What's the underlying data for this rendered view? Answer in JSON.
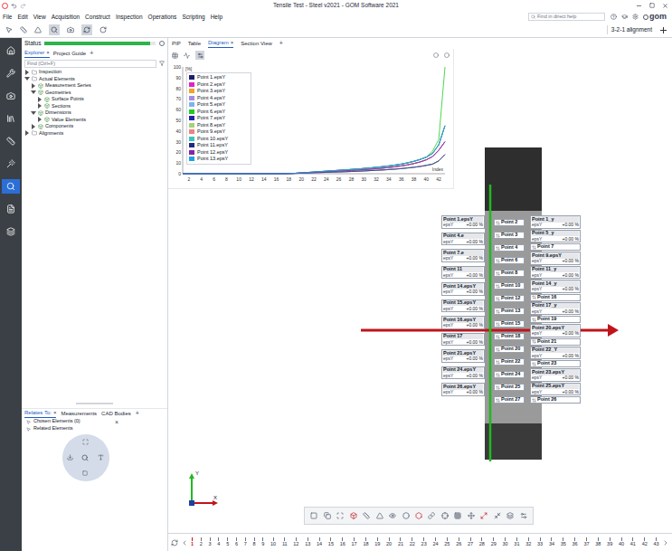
{
  "window": {
    "title": "Tensile Test - Steel v2021 - GOM Software 2021"
  },
  "menu": [
    "File",
    "Edit",
    "View",
    "Acquisition",
    "Construct",
    "Inspection",
    "Operations",
    "Scripting",
    "Help"
  ],
  "help_search": {
    "placeholder": "Find in direct help"
  },
  "logo": "gom",
  "toolbar": {
    "alignment": "3-2-1 alignment"
  },
  "sidebar": {
    "items": [
      {
        "selected": false
      },
      {
        "selected": false
      },
      {
        "selected": false
      },
      {
        "selected": false
      },
      {
        "selected": false
      },
      {
        "selected": false
      },
      {
        "selected": true
      },
      {
        "selected": false
      },
      {
        "selected": false
      }
    ]
  },
  "status": {
    "label": "Status",
    "level": 0.95
  },
  "explorer": {
    "tabs": [
      {
        "label": "Explorer",
        "selected": true,
        "close": "×"
      },
      {
        "label": "Project Guide",
        "selected": false,
        "close": ""
      }
    ],
    "add": "+",
    "filter": {
      "placeholder": "Find (Ctrl+F)"
    },
    "tree": [
      {
        "label": "Inspection",
        "level": 0,
        "expanded": false
      },
      {
        "label": "Actual Elements",
        "level": 0,
        "expanded": true
      },
      {
        "label": "Measurement Series",
        "level": 1,
        "expanded": false
      },
      {
        "label": "Geometries",
        "level": 1,
        "expanded": true
      },
      {
        "label": "Surface Points",
        "level": 2,
        "expanded": false
      },
      {
        "label": "Sections",
        "level": 2,
        "expanded": false
      },
      {
        "label": "Dimensions",
        "level": 1,
        "expanded": true
      },
      {
        "label": "Value Elements",
        "level": 2,
        "expanded": false
      },
      {
        "label": "Components",
        "level": 1,
        "expanded": false
      },
      {
        "label": "Alignments",
        "level": 0,
        "expanded": false
      }
    ]
  },
  "relates": {
    "tabs": [
      {
        "label": "Relates To:",
        "selected": true,
        "close": "×"
      },
      {
        "label": "Measurements",
        "selected": false,
        "close": ""
      },
      {
        "label": "CAD Bodies",
        "selected": false,
        "close": ""
      }
    ],
    "add": "+",
    "rows": [
      {
        "label": "Chosen Elements (0)",
        "close": "×"
      },
      {
        "label": "Related Elements",
        "close": ""
      }
    ]
  },
  "main_tabs": {
    "tabs": [
      {
        "label": "PIP",
        "selected": false,
        "close": ""
      },
      {
        "label": "Table",
        "selected": false,
        "close": ""
      },
      {
        "label": "Diagram",
        "selected": true,
        "close": "×"
      },
      {
        "label": "Section View",
        "selected": false,
        "close": ""
      }
    ],
    "add": "+"
  },
  "chart": {
    "unit": "[%]",
    "y_max": 100,
    "x_label": "Index",
    "y_ticks": [
      "0",
      "10",
      "20",
      "30",
      "40",
      "50",
      "60",
      "70",
      "80",
      "90",
      "100"
    ],
    "x_ticks": [
      "2",
      "4",
      "6",
      "8",
      "10",
      "12",
      "14",
      "16",
      "18",
      "20",
      "22",
      "24",
      "26",
      "28",
      "30",
      "32",
      "34",
      "36",
      "38",
      "40",
      "42"
    ],
    "series": [
      {
        "name": "Point 1.epsY",
        "color": "#1b1f6e",
        "values": [
          0,
          0,
          0,
          0,
          0,
          0,
          0,
          0,
          0,
          0,
          0,
          0,
          0,
          0,
          0,
          0,
          0,
          0.2,
          0.4,
          0.7,
          1.0,
          1.3,
          1.6,
          1.9,
          2.2,
          2.5,
          2.8,
          3.1,
          3.4,
          3.8,
          4.2,
          4.7,
          5.2,
          5.8,
          6.5,
          7.3,
          8.3,
          9.5,
          11,
          13,
          16,
          22,
          30
        ]
      },
      {
        "name": "Point 2.epsY",
        "color": "#e021c4",
        "values": [
          0,
          0,
          0,
          0,
          0,
          0,
          0,
          0,
          0,
          0,
          0,
          0,
          0,
          0,
          0,
          0,
          0,
          0.2,
          0.3,
          0.5,
          0.7,
          0.9,
          1.1,
          1.3,
          1.5,
          1.7,
          1.9,
          2.1,
          2.3,
          2.6,
          2.9,
          3.2,
          3.5,
          3.9,
          4.3,
          4.8,
          5.4,
          6.0,
          6.8,
          7.8,
          9.0,
          12,
          18
        ]
      },
      {
        "name": "Point 3.epsY",
        "color": "#f2a12a",
        "values": [
          0,
          0,
          0,
          0,
          0,
          0,
          0,
          0,
          0,
          0,
          0,
          0,
          0,
          0,
          0,
          0,
          0,
          0.2,
          0.4,
          0.8,
          1.2,
          1.6,
          2.0,
          2.4,
          2.8,
          3.2,
          3.6,
          4.0,
          4.4,
          4.9,
          5.4,
          6.0,
          6.6,
          7.3,
          8.1,
          9.0,
          10.2,
          11.6,
          13.3,
          15.5,
          19,
          27,
          45
        ]
      },
      {
        "name": "Point 4.epsY",
        "color": "#a08de0",
        "values": [
          0,
          0,
          0,
          0,
          0,
          0,
          0,
          0,
          0,
          0,
          0,
          0,
          0,
          0,
          0,
          0,
          0,
          0.2,
          0.4,
          0.7,
          1.0,
          1.3,
          1.6,
          1.9,
          2.2,
          2.5,
          2.8,
          3.1,
          3.4,
          3.8,
          4.2,
          4.7,
          5.2,
          5.8,
          6.5,
          7.3,
          8.3,
          9.5,
          11,
          13,
          16,
          22,
          30
        ]
      },
      {
        "name": "Point 5.epsY",
        "color": "#7fb2f0",
        "values": [
          0,
          0,
          0,
          0,
          0,
          0,
          0,
          0,
          0,
          0,
          0,
          0,
          0,
          0,
          0,
          0,
          0,
          0.2,
          0.3,
          0.5,
          0.7,
          0.9,
          1.1,
          1.3,
          1.5,
          1.7,
          1.9,
          2.1,
          2.3,
          2.6,
          2.9,
          3.2,
          3.5,
          3.9,
          4.3,
          4.8,
          5.4,
          6.0,
          6.8,
          7.8,
          9.0,
          12,
          18
        ]
      },
      {
        "name": "Point 6.epsY",
        "color": "#22cc22",
        "values": [
          0,
          0,
          0,
          0,
          0,
          0,
          0,
          0,
          0,
          0,
          0,
          0,
          0,
          0,
          0,
          0,
          0,
          0.2,
          0.4,
          0.8,
          1.2,
          1.6,
          2.0,
          2.4,
          2.8,
          3.2,
          3.6,
          4.0,
          4.4,
          4.9,
          5.4,
          6.0,
          6.6,
          7.3,
          8.1,
          9.0,
          10.2,
          11.6,
          13.3,
          15.5,
          21,
          32,
          100
        ]
      },
      {
        "name": "Point 7.epsY",
        "color": "#2424a8",
        "values": [
          0,
          0,
          0,
          0,
          0,
          0,
          0,
          0,
          0,
          0,
          0,
          0,
          0,
          0,
          0,
          0,
          0,
          0.2,
          0.4,
          0.8,
          1.2,
          1.6,
          2.0,
          2.4,
          2.8,
          3.2,
          3.6,
          4.0,
          4.4,
          4.9,
          5.4,
          6.0,
          6.6,
          7.3,
          8.1,
          9.0,
          10.2,
          11.6,
          13.3,
          15.5,
          19,
          27,
          45
        ]
      },
      {
        "name": "Point 8.epsY",
        "color": "#a2d37e",
        "values": [
          0,
          0,
          0,
          0,
          0,
          0,
          0,
          0,
          0,
          0,
          0,
          0,
          0,
          0,
          0,
          0,
          0,
          0.2,
          0.3,
          0.5,
          0.7,
          0.9,
          1.1,
          1.3,
          1.5,
          1.7,
          1.9,
          2.1,
          2.3,
          2.6,
          2.9,
          3.2,
          3.5,
          3.9,
          4.3,
          4.8,
          5.4,
          6.0,
          6.8,
          7.8,
          9.0,
          12,
          18
        ]
      },
      {
        "name": "Point 9.epsY",
        "color": "#f08282",
        "values": [
          0,
          0,
          0,
          0,
          0,
          0,
          0,
          0,
          0,
          0,
          0,
          0,
          0,
          0,
          0,
          0,
          0,
          0.2,
          0.4,
          0.7,
          1.0,
          1.3,
          1.6,
          1.9,
          2.2,
          2.5,
          2.8,
          3.1,
          3.4,
          3.8,
          4.2,
          4.7,
          5.2,
          5.8,
          6.5,
          7.3,
          8.3,
          9.5,
          11,
          13,
          16,
          22,
          30
        ]
      },
      {
        "name": "Point 10.epsY",
        "color": "#3fc2c2",
        "values": [
          0,
          0,
          0,
          0,
          0,
          0,
          0,
          0,
          0,
          0,
          0,
          0,
          0,
          0,
          0,
          0,
          0,
          0.2,
          0.4,
          0.8,
          1.2,
          1.6,
          2.0,
          2.4,
          2.8,
          3.2,
          3.6,
          4.0,
          4.4,
          4.9,
          5.4,
          6.0,
          6.6,
          7.3,
          8.1,
          9.0,
          10.2,
          11.6,
          13.3,
          15.5,
          19,
          27,
          45
        ]
      },
      {
        "name": "Point 11.epsY",
        "color": "#1f2a80",
        "values": [
          0,
          0,
          0,
          0,
          0,
          0,
          0,
          0,
          0,
          0,
          0,
          0,
          0,
          0,
          0,
          0,
          0,
          0.2,
          0.3,
          0.5,
          0.7,
          0.9,
          1.1,
          1.3,
          1.5,
          1.7,
          1.9,
          2.1,
          2.3,
          2.6,
          2.9,
          3.2,
          3.5,
          3.9,
          4.3,
          4.8,
          5.4,
          6.0,
          6.8,
          7.8,
          9.0,
          12,
          18
        ]
      },
      {
        "name": "Point 12.epsY",
        "color": "#8624a4",
        "values": [
          0,
          0,
          0,
          0,
          0,
          0,
          0,
          0,
          0,
          0,
          0,
          0,
          0,
          0,
          0,
          0,
          0,
          0.2,
          0.4,
          0.7,
          1.0,
          1.3,
          1.6,
          1.9,
          2.2,
          2.5,
          2.8,
          3.1,
          3.4,
          3.8,
          4.2,
          4.7,
          5.2,
          5.8,
          6.5,
          7.3,
          8.3,
          9.5,
          11,
          13,
          16,
          22,
          30
        ]
      },
      {
        "name": "Point 13.epsY",
        "color": "#20a2e2",
        "values": [
          0,
          0,
          0,
          0,
          0,
          0,
          0,
          0,
          0,
          0,
          0,
          0,
          0,
          0,
          0,
          0,
          0,
          0.2,
          0.4,
          0.8,
          1.2,
          1.6,
          2.0,
          2.4,
          2.8,
          3.2,
          3.6,
          4.0,
          4.4,
          4.9,
          5.4,
          6.0,
          6.6,
          7.3,
          8.1,
          9.0,
          10.2,
          11.6,
          13.3,
          15.5,
          19,
          27,
          45
        ]
      }
    ]
  },
  "view": {
    "left_labels": [
      {
        "name": "Point 1.epsY",
        "quantity": "epsY",
        "value": "+0.00 %"
      },
      {
        "name": "Point 4.e",
        "quantity": "epsY",
        "value": "+0.00 %"
      },
      {
        "name": "Point 7.e",
        "quantity": "epsY",
        "value": "+0.00 %"
      },
      {
        "name": "Point 11",
        "quantity": "epsY",
        "value": "+0.00 %"
      },
      {
        "name": "Point 14.epsY",
        "quantity": "epsY",
        "value": "+0.00 %"
      },
      {
        "name": "Point 15.epsY",
        "quantity": "epsY",
        "value": "+0.00 %"
      },
      {
        "name": "Point 16.epsY",
        "quantity": "epsY",
        "value": "+0.00 %"
      },
      {
        "name": "Point 17",
        "quantity": "epsY",
        "value": "+0.00 %"
      },
      {
        "name": "Point 21.epsY",
        "quantity": "epsY",
        "value": "+0.00 %"
      },
      {
        "name": "Point 24.epsY",
        "quantity": "epsY",
        "value": "+0.00 %"
      },
      {
        "name": "Point 26.epsY",
        "quantity": "epsY",
        "value": "+0.00 %"
      }
    ],
    "flags": [
      "Point 2",
      "Point 3",
      "Point 4",
      "Point 6",
      "Point 8",
      "Point 10",
      "Point 12",
      "Point 13",
      "Point 15",
      "Point 18",
      "Point 20",
      "Point 22",
      "Point 24",
      "Point 25",
      "Point 27"
    ],
    "right_labels": [
      {
        "kind": "tag",
        "name": "Point 1_y",
        "quantity": "epsY",
        "value": "+0.00 %"
      },
      {
        "kind": "tag",
        "name": "Point 5_y",
        "quantity": "epsY",
        "value": "+0.00 %"
      },
      {
        "kind": "flag",
        "name": "Point 7",
        "quantity": "",
        "value": ""
      },
      {
        "kind": "tag",
        "name": "Point 9.epsY",
        "quantity": "epsY",
        "value": "+0.00 %"
      },
      {
        "kind": "tag",
        "name": "Point 11_y",
        "quantity": "epsY",
        "value": "+0.00 %"
      },
      {
        "kind": "tag",
        "name": "Point 14_y",
        "quantity": "epsY",
        "value": "+0.00 %"
      },
      {
        "kind": "flag",
        "name": "Point 16",
        "quantity": "",
        "value": ""
      },
      {
        "kind": "tag",
        "name": "Point 17_y",
        "quantity": "epsY",
        "value": "+0.00 %"
      },
      {
        "kind": "flag",
        "name": "Point 19",
        "quantity": "",
        "value": ""
      },
      {
        "kind": "tag",
        "name": "Point 20.epsY",
        "quantity": "epsY",
        "value": "+0.00 %"
      },
      {
        "kind": "flag",
        "name": "Point 21",
        "quantity": "",
        "value": ""
      },
      {
        "kind": "tag",
        "name": "Point 22_Y",
        "quantity": "epsY",
        "value": "+0.00 %"
      },
      {
        "kind": "flag",
        "name": "Point 23",
        "quantity": "",
        "value": ""
      },
      {
        "kind": "tag",
        "name": "Point 23.epsY",
        "quantity": "epsY",
        "value": "+0.00 %"
      },
      {
        "kind": "tag",
        "name": "Point 25.epsY",
        "quantity": "epsY",
        "value": "+0.00 %"
      },
      {
        "kind": "flag",
        "name": "Point 26",
        "quantity": "",
        "value": ""
      }
    ],
    "axes": {
      "x": "X",
      "y": "Y"
    }
  },
  "timeline": {
    "ticks": [
      {
        "label": "1",
        "selected": true
      },
      {
        "label": "2",
        "selected": false
      },
      {
        "label": "3",
        "selected": false
      },
      {
        "label": "4",
        "selected": false
      },
      {
        "label": "5",
        "selected": false
      },
      {
        "label": "6",
        "selected": false
      },
      {
        "label": "7",
        "selected": false
      },
      {
        "label": "8",
        "selected": false
      },
      {
        "label": "9",
        "selected": false
      },
      {
        "label": "10",
        "selected": false
      },
      {
        "label": "11",
        "selected": false
      },
      {
        "label": "12",
        "selected": false
      },
      {
        "label": "13",
        "selected": false
      },
      {
        "label": "14",
        "selected": false
      },
      {
        "label": "15",
        "selected": false
      },
      {
        "label": "16",
        "selected": false
      },
      {
        "label": "17",
        "selected": false
      },
      {
        "label": "18",
        "selected": false
      },
      {
        "label": "19",
        "selected": false
      },
      {
        "label": "20",
        "selected": false
      },
      {
        "label": "21",
        "selected": false
      },
      {
        "label": "22",
        "selected": false
      },
      {
        "label": "23",
        "selected": false
      },
      {
        "label": "24",
        "selected": false
      },
      {
        "label": "25",
        "selected": false
      },
      {
        "label": "26",
        "selected": false
      },
      {
        "label": "27",
        "selected": false
      },
      {
        "label": "28",
        "selected": false
      },
      {
        "label": "29",
        "selected": false
      },
      {
        "label": "30",
        "selected": false
      },
      {
        "label": "31",
        "selected": false
      },
      {
        "label": "32",
        "selected": false
      },
      {
        "label": "33",
        "selected": false
      },
      {
        "label": "34",
        "selected": false
      },
      {
        "label": "35",
        "selected": false
      },
      {
        "label": "36",
        "selected": false
      },
      {
        "label": "37",
        "selected": false
      },
      {
        "label": "38",
        "selected": false
      },
      {
        "label": "39",
        "selected": false
      },
      {
        "label": "40",
        "selected": false
      },
      {
        "label": "41",
        "selected": false
      },
      {
        "label": "42",
        "selected": false
      },
      {
        "label": "43",
        "selected": false
      }
    ]
  }
}
